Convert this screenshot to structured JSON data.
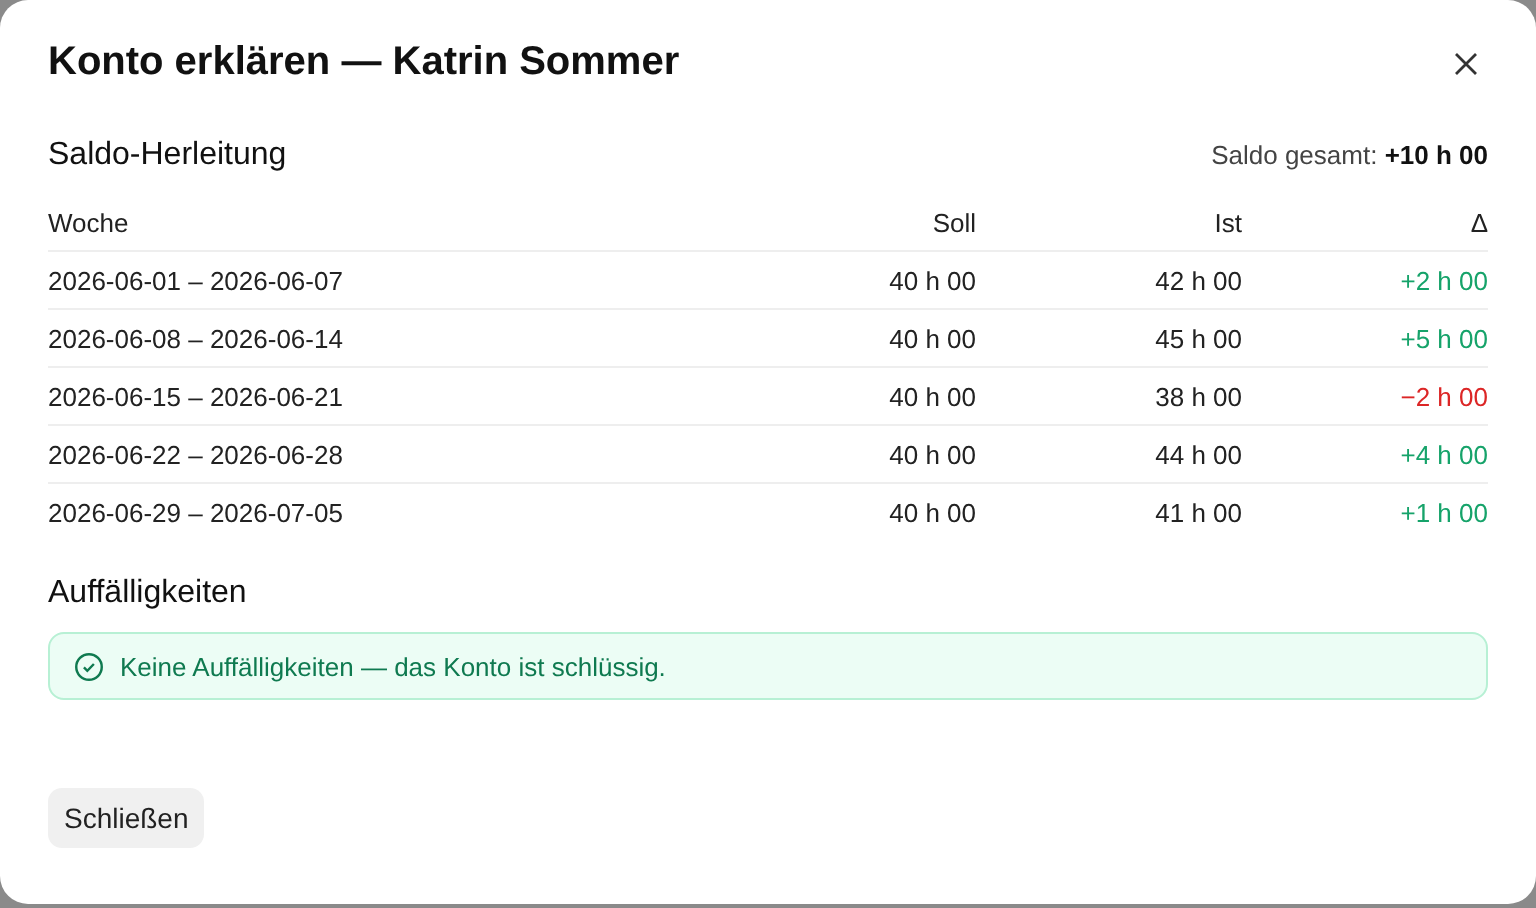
{
  "dialog": {
    "title": "Konto erklären — Katrin Sommer"
  },
  "derivation": {
    "heading": "Saldo-Herleitung",
    "total": "Saldo gesamt: **+10 h 00**",
    "columns": [
      "Woche",
      "Soll",
      "Ist",
      "Δ"
    ],
    "rows": [
      {
        "week": "2026-06-01 – 2026-06-07",
        "target": "40 h 00",
        "actual": "42 h 00",
        "delta": "+2 h 00",
        "color": "#16a36a"
      },
      {
        "week": "2026-06-08 – 2026-06-14",
        "target": "40 h 00",
        "actual": "45 h 00",
        "delta": "+5 h 00",
        "color": "#16a36a"
      },
      {
        "week": "2026-06-15 – 2026-06-21",
        "target": "40 h 00",
        "actual": "38 h 00",
        "delta": "−2 h 00",
        "color": "#dc2626"
      },
      {
        "week": "2026-06-22 – 2026-06-28",
        "target": "40 h 00",
        "actual": "44 h 00",
        "delta": "+4 h 00",
        "color": "#16a36a"
      },
      {
        "week": "2026-06-29 – 2026-07-05",
        "target": "40 h 00",
        "actual": "41 h 00",
        "delta": "+1 h 00",
        "color": "#16a36a"
      }
    ]
  },
  "findings": {
    "heading": "Auffälligkeiten",
    "message": "Keine Auffälligkeiten — das Konto ist schlüssig."
  },
  "buttons": [
    "Schließen"
  ]
}
